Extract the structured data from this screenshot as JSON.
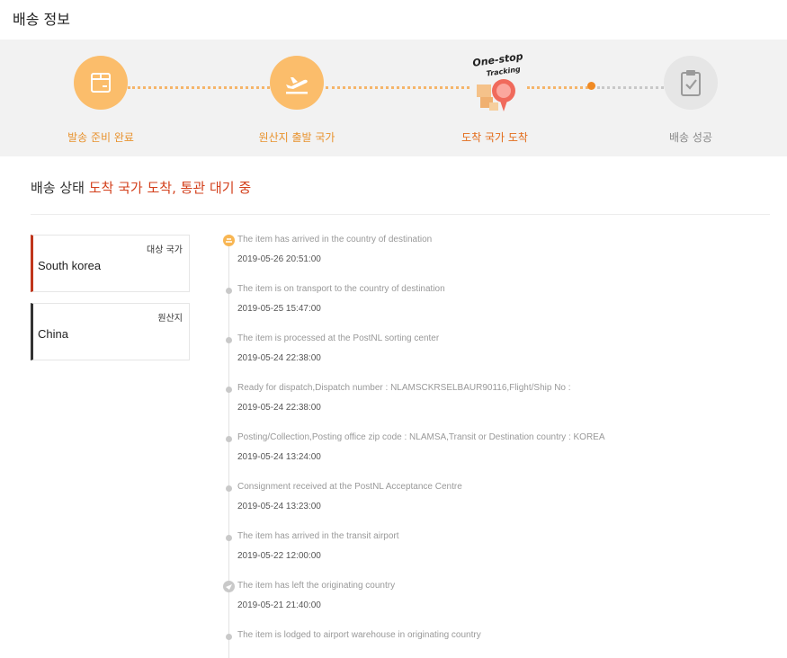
{
  "header": {
    "title": "배송 정보"
  },
  "progress": {
    "steps": [
      {
        "label": "발송 준비 완료",
        "icon": "package-icon",
        "state": "done"
      },
      {
        "label": "원산지 출발 국가",
        "icon": "plane-takeoff-icon",
        "state": "done"
      },
      {
        "label": "도착 국가 도착",
        "icon": "one-stop-tracking-icon",
        "state": "current"
      },
      {
        "label": "배송 성공",
        "icon": "clipboard-check-icon",
        "state": "pending"
      }
    ],
    "badge_line1": "One-stop",
    "badge_line2": "Tracking"
  },
  "status": {
    "prefix": "배송 상태",
    "highlight": "도착 국가 도착, 통관 대기 중"
  },
  "destination": {
    "label": "대상 국가",
    "value": "South korea"
  },
  "origin": {
    "label": "원산지",
    "value": "China"
  },
  "timeline": [
    {
      "desc": "The item has arrived in the country of destination",
      "time": "2019-05-26 20:51:00"
    },
    {
      "desc": "The item is on transport to the country of destination",
      "time": "2019-05-25 15:47:00"
    },
    {
      "desc": "The item is processed at the PostNL sorting center",
      "time": "2019-05-24 22:38:00"
    },
    {
      "desc": "Ready for dispatch,Dispatch number : NLAMSCKRSELBAUR90116,Flight/Ship No :",
      "time": "2019-05-24 22:38:00"
    },
    {
      "desc": "Posting/Collection,Posting office zip code : NLAMSA,Transit or Destination country : KOREA",
      "time": "2019-05-24 13:24:00"
    },
    {
      "desc": "Consignment received at the PostNL Acceptance Centre",
      "time": "2019-05-24 13:23:00"
    },
    {
      "desc": "The item has arrived in the transit airport",
      "time": "2019-05-22 12:00:00"
    },
    {
      "desc": "The item has left the originating country",
      "time": "2019-05-21 21:40:00"
    },
    {
      "desc": "The item is lodged to airport warehouse in originating country",
      "time": ""
    }
  ],
  "colors": {
    "accent": "#fbbd6b",
    "highlight": "#d3401c",
    "current_step": "#e36d1c"
  }
}
